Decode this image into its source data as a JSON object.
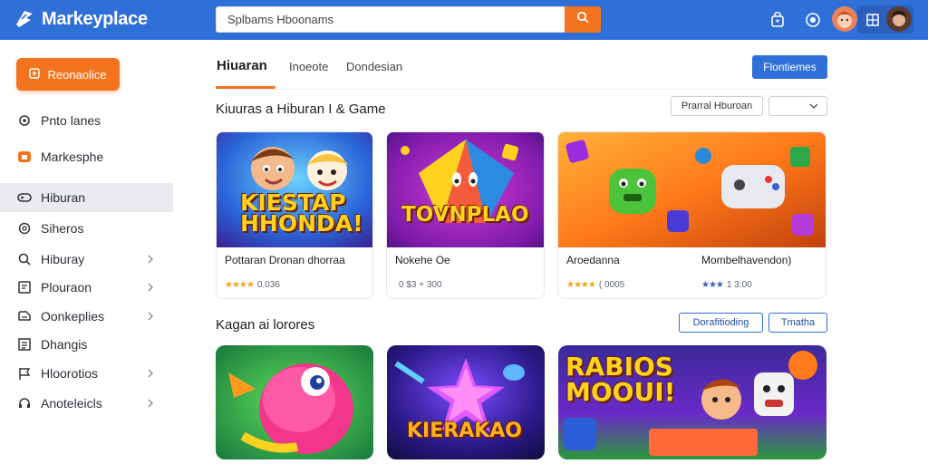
{
  "header": {
    "app_name": "Markeyplace",
    "search_placeholder": "Splbams Hboonams",
    "brand_color": "#2f6fd8",
    "accent_color": "#f4731f",
    "icons": [
      "logo-icon",
      "search-icon",
      "bag-icon",
      "eye-icon",
      "avatar",
      "grid-icon",
      "avatar"
    ]
  },
  "sidebar": {
    "primary_button": "Reonaolice",
    "items": [
      {
        "label": "Pnto lanes",
        "icon": "gear-icon"
      },
      {
        "label": "Markesphe",
        "icon": "store-icon"
      },
      {
        "label": "Hiburan",
        "icon": "controller-icon",
        "active": true
      },
      {
        "label": "Siheros",
        "icon": "settings-icon"
      },
      {
        "label": "Hiburay",
        "icon": "search-icon",
        "chevron": true
      },
      {
        "label": "Plouraon",
        "icon": "chat-icon",
        "chevron": true
      },
      {
        "label": "Oonkeplies",
        "icon": "gamepad-icon",
        "chevron": true
      },
      {
        "label": "Dhangis",
        "icon": "calendar-icon"
      },
      {
        "label": "Hloorotios",
        "icon": "flag-icon",
        "chevron": true
      },
      {
        "label": "Anoteleicls",
        "icon": "headset-icon",
        "chevron": true
      }
    ]
  },
  "main": {
    "tabs": [
      {
        "label": "Hiuaran",
        "active": true
      },
      {
        "label": "Inoeote"
      },
      {
        "label": "Dondesian"
      }
    ],
    "action_button": "Flontiemes",
    "section1": {
      "title": "Kiuuras a Hiburan I & Game",
      "filter_label": "Prarral Hburoan",
      "dropdown_value": "",
      "cards": [
        {
          "thumb_text": "KIESTAP HHONDA!",
          "title": "Pottaran Dronan dhorraa",
          "rating": "★★★★",
          "meta": "0.036"
        },
        {
          "thumb_text": "TOVNPLAO",
          "title": "Nokehe Oe",
          "rating": "",
          "meta": "0 $3 + 300"
        },
        {
          "thumb_text": "",
          "title": "Aroedanna",
          "rating": "★★★★",
          "meta": "( 0005"
        },
        {
          "thumb_text": "",
          "title": "Mombelhavendon)",
          "rating": "★★★",
          "meta": "1 3:00"
        }
      ]
    },
    "section2": {
      "title": "Kagan ai lorores",
      "button_1": "Dorafitioding",
      "button_2": "Tmatha",
      "cards": [
        {
          "thumb_text": ""
        },
        {
          "thumb_text": "KIERAKAO"
        },
        {
          "thumb_text": "RABIOS MOOUI!"
        }
      ]
    }
  }
}
